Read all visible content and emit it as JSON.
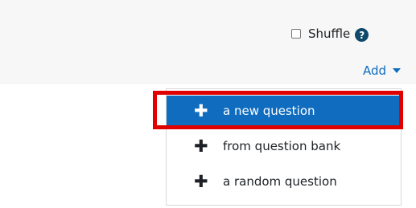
{
  "shuffle": {
    "label": "Shuffle",
    "checked": false,
    "help_icon": "help-question-icon",
    "help_glyph": "?"
  },
  "add": {
    "label": "Add",
    "icon": "caret-down-icon"
  },
  "menu": {
    "items": [
      {
        "label": "a new question",
        "icon": "plus-icon",
        "glyph": "✚",
        "active": true
      },
      {
        "label": "from question bank",
        "icon": "plus-icon",
        "glyph": "✚",
        "active": false
      },
      {
        "label": "a random question",
        "icon": "plus-icon",
        "glyph": "✚",
        "active": false
      }
    ]
  },
  "colors": {
    "accent": "#0f6cbf",
    "highlight_border": "#e00000",
    "help_icon": "#0f4a6b"
  }
}
